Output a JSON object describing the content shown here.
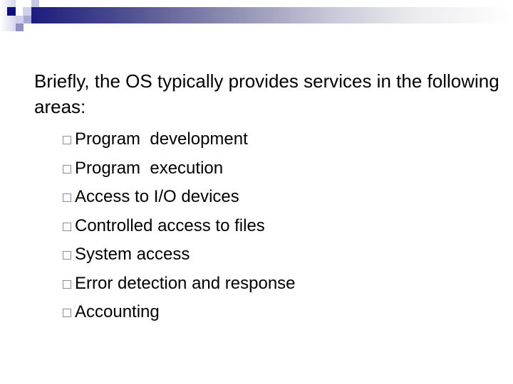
{
  "slide": {
    "intro": "Briefly, the OS typically provides services in the following areas:",
    "bullets": [
      {
        "icon": "hollow-square-bullet-icon",
        "label": "Program  development"
      },
      {
        "icon": "hollow-square-bullet-icon",
        "label": "Program  execution"
      },
      {
        "icon": "hollow-square-bullet-icon",
        "label": "Access to I/O devices"
      },
      {
        "icon": "hollow-square-bullet-icon",
        "label": "Controlled access to files"
      },
      {
        "icon": "hollow-square-bullet-icon",
        "label": "System access"
      },
      {
        "icon": "hollow-square-bullet-icon",
        "label": "Error detection and response"
      },
      {
        "icon": "hollow-square-bullet-icon",
        "label": "Accounting"
      }
    ]
  },
  "theme": {
    "accent_dark": "#1c1c7e",
    "accent_medium": "#9a9ac8",
    "accent_light": "#d4d4ea",
    "bullet_color": "#8a8aa8",
    "text_color": "#000000"
  }
}
